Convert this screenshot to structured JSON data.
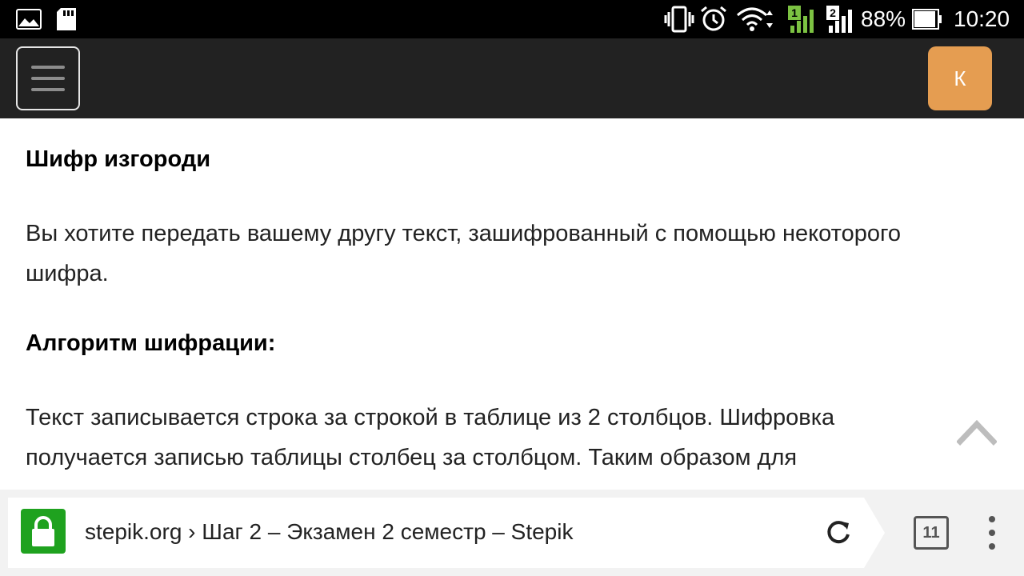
{
  "status_bar": {
    "battery_percent": "88%",
    "time": "10:20",
    "sim1": "1",
    "sim2": "2"
  },
  "top_bar": {
    "avatar_letter": "К"
  },
  "article": {
    "title": "Шифр изгороди",
    "intro": "Вы хотите передать вашему другу текст, зашифрованный с помощью некоторого шифра.",
    "algorithm_heading": "Алгоритм шифрации:",
    "algorithm_text": "Текст записывается строка за строкой в таблице из 2 столбцов. Шифровка получается записью таблицы столбец за столбцом. Таким образом для"
  },
  "browser_bar": {
    "url_text": "stepik.org › Шаг 2 – Экзамен 2 семестр – Stepik",
    "tab_count": "11"
  },
  "colors": {
    "status_bar_bg": "#000000",
    "top_bar_bg": "#222222",
    "avatar_bg": "#e59d51",
    "lock_bg": "#1fa21f",
    "signal_sim1": "#7cc242"
  }
}
